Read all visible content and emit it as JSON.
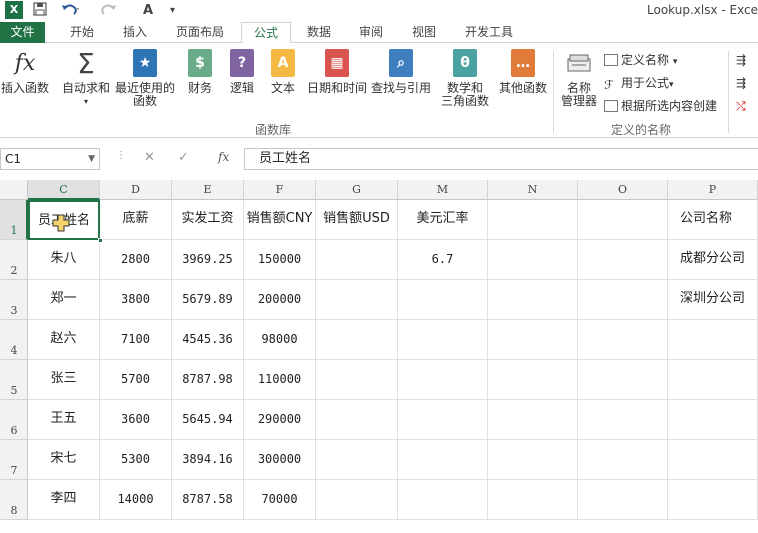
{
  "window": {
    "title": "Lookup.xlsx - Exce",
    "app_icon": "X",
    "quick_access": [
      "save-icon",
      "undo-icon",
      "redo-icon",
      "font-icon"
    ]
  },
  "tabs": [
    "文件",
    "开始",
    "插入",
    "页面布局",
    "公式",
    "数据",
    "审阅",
    "视图",
    "开发工具"
  ],
  "ribbon": {
    "insert_function": "插入函数",
    "autosum": "自动求和",
    "recent": [
      "最近使用的",
      "函数"
    ],
    "finance": "财务",
    "logic": "逻辑",
    "text": "文本",
    "datetime": "日期和时间",
    "lookup": "查找与引用",
    "math": [
      "数学和",
      "三角函数"
    ],
    "other": "其他函数",
    "group_library": "函数库",
    "name_manager": [
      "名称",
      "管理器"
    ],
    "define_name": "定义名称",
    "use_in_formula": "用于公式",
    "create_from_selection": "根据所选内容创建",
    "group_names": "定义的名称"
  },
  "formula_bar": {
    "name_box": "C1",
    "content": "员工姓名"
  },
  "columns": [
    "C",
    "D",
    "E",
    "F",
    "G",
    "M",
    "N",
    "O",
    "P"
  ],
  "rows": [
    "1",
    "2",
    "3",
    "4",
    "5",
    "6",
    "7",
    "8"
  ],
  "cells": [
    [
      "员工姓名",
      "底薪",
      "实发工资",
      "销售额CNY",
      "销售额USD",
      "美元汇率",
      "",
      "",
      "公司名称"
    ],
    [
      "朱八",
      "2800",
      "3969.25",
      "150000",
      "",
      "6.7",
      "",
      "",
      "成都分公司"
    ],
    [
      "郑一",
      "3800",
      "5679.89",
      "200000",
      "",
      "",
      "",
      "",
      "深圳分公司"
    ],
    [
      "赵六",
      "7100",
      "4545.36",
      "98000",
      "",
      "",
      "",
      "",
      ""
    ],
    [
      "张三",
      "5700",
      "8787.98",
      "110000",
      "",
      "",
      "",
      "",
      ""
    ],
    [
      "王五",
      "3600",
      "5645.94",
      "290000",
      "",
      "",
      "",
      "",
      ""
    ],
    [
      "宋七",
      "5300",
      "3894.16",
      "300000",
      "",
      "",
      "",
      "",
      ""
    ],
    [
      "李四",
      "14000",
      "8787.58",
      "70000",
      "",
      "",
      "",
      "",
      ""
    ]
  ],
  "colors": {
    "accent": "#217346"
  }
}
